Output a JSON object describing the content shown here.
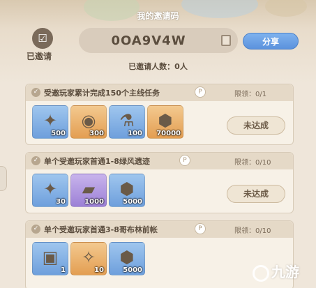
{
  "header": {
    "title": "我的邀请码",
    "invited_label": "已邀请",
    "invite_code": "0OA9V4W",
    "share_label": "分享",
    "invited_count": "已邀请人数：0人"
  },
  "tasks": [
    {
      "title": "受邀玩家累计完成150个主线任务",
      "limit": "限领：0/1",
      "status": "未达成",
      "rewards": [
        {
          "icon": "blue-star-crystal-icon",
          "qty": "500",
          "rarity": "blue"
        },
        {
          "icon": "gold-orb-artifact-icon",
          "qty": "300",
          "rarity": "orange"
        },
        {
          "icon": "blue-potion-canister-icon",
          "qty": "100",
          "rarity": "blue"
        },
        {
          "icon": "gold-coin-icon",
          "qty": "70000",
          "rarity": "orange"
        }
      ]
    },
    {
      "title": "单个受邀玩家首通1-8绿风遗迹",
      "limit": "限领：0/10",
      "status": "未达成",
      "rewards": [
        {
          "icon": "blue-star-crystal-icon",
          "qty": "30",
          "rarity": "blue"
        },
        {
          "icon": "silver-ingot-icon",
          "qty": "1000",
          "rarity": "purple"
        },
        {
          "icon": "gold-coin-icon",
          "qty": "5000",
          "rarity": "blue"
        }
      ]
    },
    {
      "title": "单个受邀玩家首通3-8哥布林前帐",
      "limit": "限领：0/10",
      "status": "",
      "rewards": [
        {
          "icon": "blue-card-book-icon",
          "qty": "1",
          "rarity": "blue"
        },
        {
          "icon": "rune-card-icon",
          "qty": "10",
          "rarity": "orange"
        },
        {
          "icon": "gold-coin-icon",
          "qty": "5000",
          "rarity": "blue"
        }
      ]
    }
  ],
  "watermark": "九游"
}
